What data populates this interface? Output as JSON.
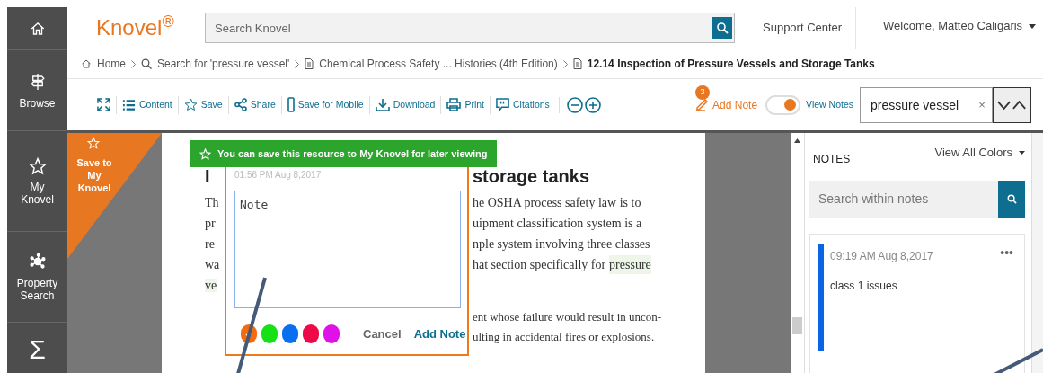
{
  "sidebar": {
    "items": [
      {
        "kind": "home"
      },
      {
        "kind": "browse",
        "label": "Browse"
      },
      {
        "kind": "star",
        "label": "My Knovel"
      },
      {
        "kind": "network",
        "label": "Property Search"
      },
      {
        "kind": "sigma",
        "glyph": "Σ"
      }
    ]
  },
  "header": {
    "logo": "Knovel$^{®}$",
    "search_placeholder": "Search Knovel",
    "support": "Support Center",
    "user": "Welcome, Matteo Caligaris"
  },
  "breadcrumb": [
    {
      "kind": "home",
      "label": "Home",
      "current": false
    },
    {
      "kind": "search",
      "label": "Search for 'pressure vessel'",
      "current": false
    },
    {
      "kind": "document",
      "label": "Chemical Process Safety ... Histories (4th Edition)",
      "current": false
    },
    {
      "kind": "document",
      "label": "12.14 Inspection of Pressure Vessels and Storage Tanks",
      "current": true
    }
  ],
  "toolbar": {
    "tools": [
      {
        "kind": "expand"
      },
      {
        "kind": "list",
        "label": "Content"
      },
      {
        "kind": "star",
        "label": "Save"
      },
      {
        "kind": "share",
        "label": "Share"
      },
      {
        "kind": "phone",
        "label": "Save for Mobile"
      },
      {
        "kind": "download",
        "label": "Download"
      },
      {
        "kind": "print",
        "label": "Print"
      },
      {
        "kind": "quote",
        "label": "Citations"
      }
    ],
    "zoom": [
      {
        "kind": "minus"
      },
      {
        "kind": "plus"
      }
    ],
    "add_note": {
      "label": "Add Note",
      "badge": "3"
    },
    "view_notes": {
      "label": "View Notes",
      "on": true
    },
    "find": {
      "value": "pressure vessel",
      "clear": "×"
    }
  },
  "save_ribbon": {
    "label": "Save to My Knovel"
  },
  "banner": {
    "text": "You can save this resource to My Knovel for later viewing"
  },
  "document": {
    "heading": [
      {
        "text": "I"
      },
      {
        "text": "storage tanks"
      }
    ],
    "lines": [
      {
        "left": "Th",
        "right": "he OSHA process safety law is to",
        "highlight": false
      },
      {
        "left": "pr",
        "right": "uipment classification system is a",
        "highlight": false
      },
      {
        "left": "re",
        "right": "nple system involving three classes",
        "highlight": false
      },
      {
        "left": "wa",
        "right": "hat section specifically for",
        "mark": "pressure",
        "highlight": false
      },
      {
        "left": "ve",
        "highlight": true
      }
    ],
    "lines_after": [
      {
        "right": "ent whose failure would result in uncon-"
      },
      {
        "right": "ulting in accidental fires or explosions."
      }
    ]
  },
  "note_popup": {
    "timestamp": "01:56 PM Aug 8,2017",
    "value": "Note",
    "colors": [
      {
        "color": "#f26b0f",
        "selected": true
      },
      {
        "color": "#16e016",
        "selected": false
      },
      {
        "color": "#0a6ef0",
        "selected": false
      },
      {
        "color": "#ee0a48",
        "selected": false
      },
      {
        "color": "#e010e8",
        "selected": false
      }
    ],
    "cancel": "Cancel",
    "submit": "Add Note"
  },
  "notes_panel": {
    "title": "NOTES",
    "filter": "View All Colors",
    "search_placeholder": "Search within notes",
    "notes": [
      {
        "color": "#0a64e6",
        "time": "09:19 AM Aug 8,2017",
        "text": "class 1 issues",
        "menu": "•••"
      }
    ]
  }
}
